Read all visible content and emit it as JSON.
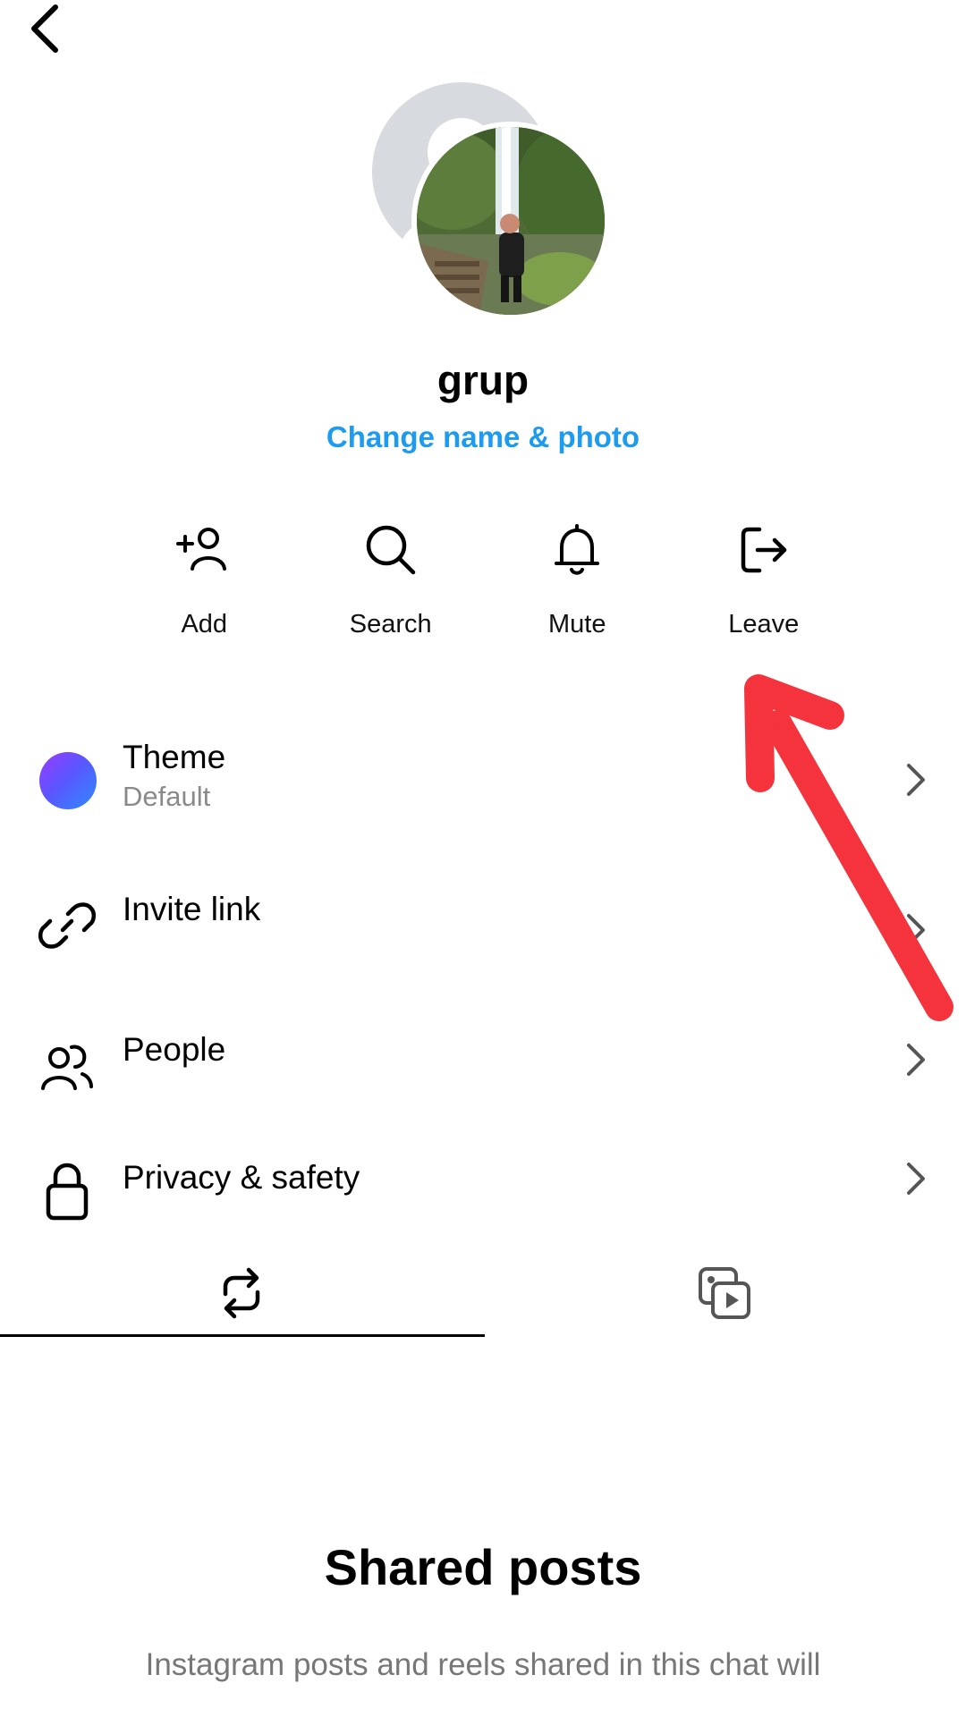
{
  "header": {
    "back_icon": "chevron-left-icon"
  },
  "group": {
    "name": "grup",
    "change_label": "Change name & photo",
    "link_color": "#1d9bf0"
  },
  "actions": [
    {
      "label": "Add",
      "icon": "add-person-icon"
    },
    {
      "label": "Search",
      "icon": "search-icon"
    },
    {
      "label": "Mute",
      "icon": "bell-icon"
    },
    {
      "label": "Leave",
      "icon": "leave-icon"
    }
  ],
  "settings": {
    "theme": {
      "title": "Theme",
      "value": "Default",
      "icon": "theme-gradient-dot"
    },
    "invite": {
      "title": "Invite link",
      "icon": "link-icon"
    },
    "people": {
      "title": "People",
      "icon": "people-icon"
    },
    "privacy": {
      "title": "Privacy & safety",
      "icon": "lock-icon"
    }
  },
  "tabs": [
    {
      "icon": "repost-icon",
      "selected": true
    },
    {
      "icon": "media-icon",
      "selected": false
    }
  ],
  "empty_state": {
    "title": "Shared posts",
    "description": "Instagram posts and reels shared in this chat will"
  },
  "annotation": {
    "arrow_color": "#f4333c"
  }
}
